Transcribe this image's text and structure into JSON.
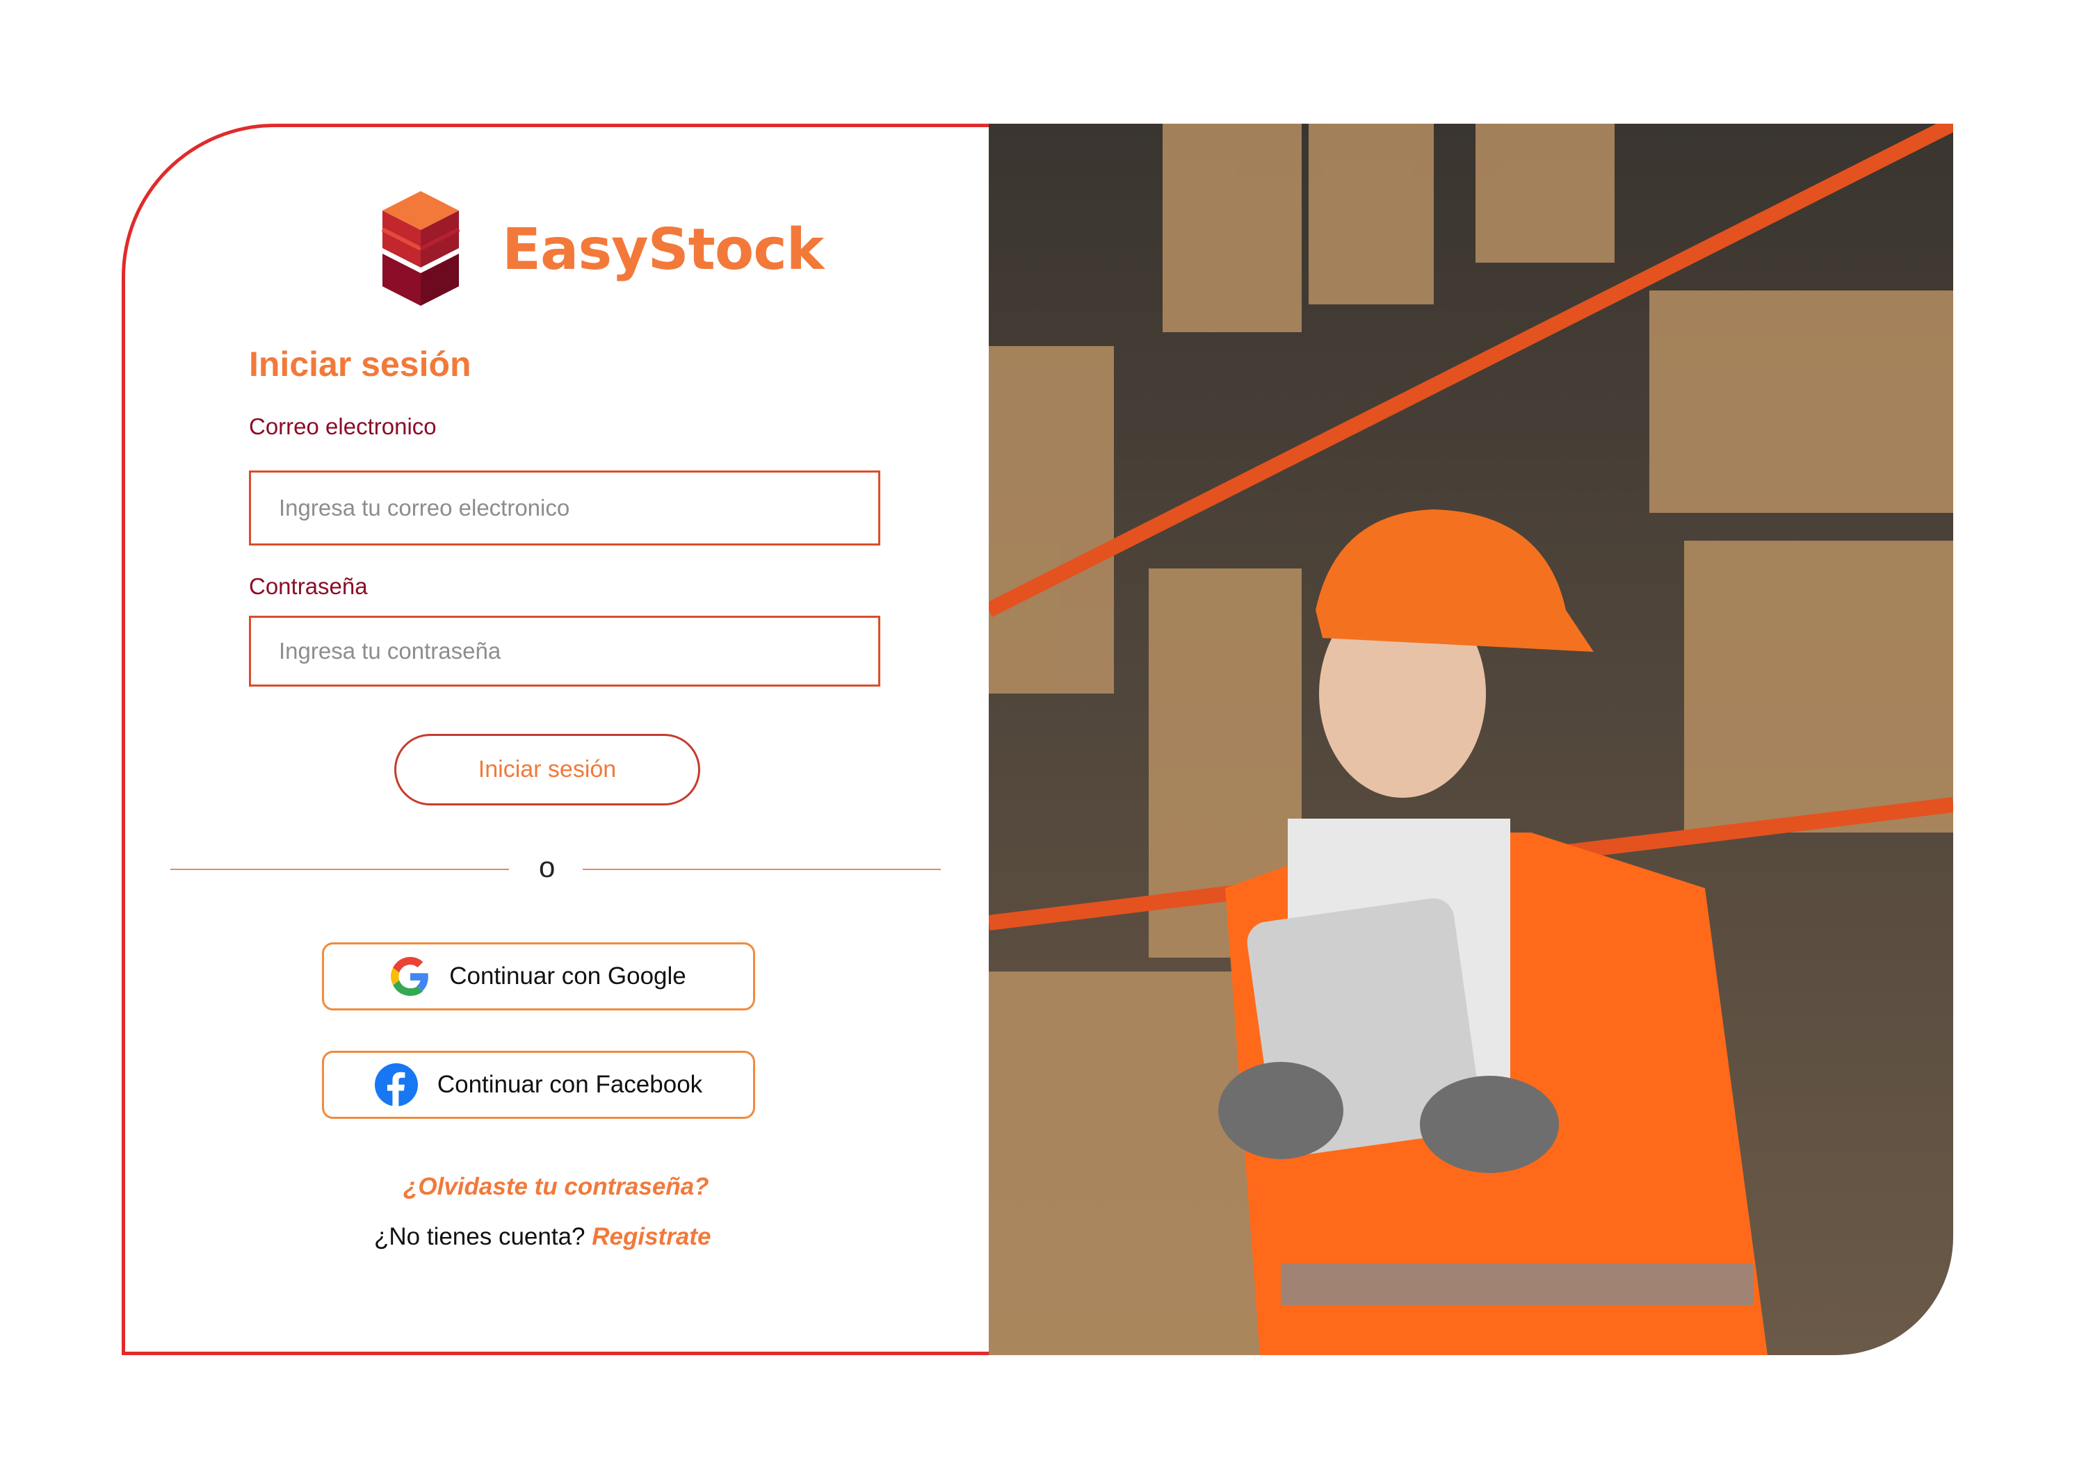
{
  "brand": {
    "name": "EasyStock",
    "logo_icon": "stacked-cube-logo"
  },
  "login": {
    "title": "Iniciar sesión",
    "email_label": "Correo electronico",
    "email_placeholder": "Ingresa tu correo electronico",
    "email_value": "",
    "password_label": "Contraseña",
    "password_placeholder": "Ingresa tu contraseña",
    "password_value": "",
    "submit_label": "Iniciar sesión"
  },
  "divider": {
    "text": "o"
  },
  "social": {
    "google_label": "Continuar con Google",
    "google_icon": "google-icon",
    "facebook_label": "Continuar con Facebook",
    "facebook_icon": "facebook-icon"
  },
  "links": {
    "forgot_password": "¿Olvidaste tu contraseña?",
    "no_account": "¿No tienes cuenta?",
    "register": "Registrate"
  },
  "colors": {
    "accent_orange": "#f2793a",
    "dark_red": "#8b0d28",
    "border_red": "#e02b2b",
    "input_border": "#d94e2b",
    "social_border": "#f08a3e"
  },
  "hero_image": {
    "subject": "warehouse-worker-with-tablet"
  }
}
